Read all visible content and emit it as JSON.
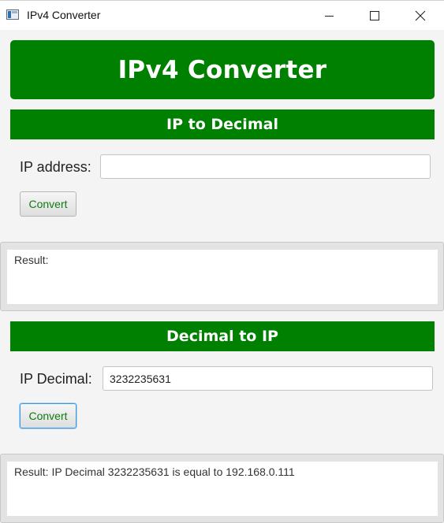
{
  "window": {
    "title": "IPv4 Converter",
    "icons": {
      "app": "app-icon",
      "minimize": "minimize-icon",
      "maximize": "maximize-icon",
      "close": "close-icon"
    }
  },
  "header": {
    "title": "IPv4 Converter"
  },
  "ip_to_decimal": {
    "section_title": "IP to Decimal",
    "field_label": "IP address:",
    "field_value": "",
    "button_label": "Convert",
    "result_text": "Result:"
  },
  "decimal_to_ip": {
    "section_title": "Decimal to IP",
    "field_label": "IP Decimal:",
    "field_value": "3232235631",
    "button_label": "Convert",
    "result_text": "Result: IP Decimal 3232235631 is equal to 192.168.0.111"
  },
  "colors": {
    "accent_green": "#008000",
    "button_text_green": "#117a11",
    "focus_blue": "#3a96dd"
  }
}
